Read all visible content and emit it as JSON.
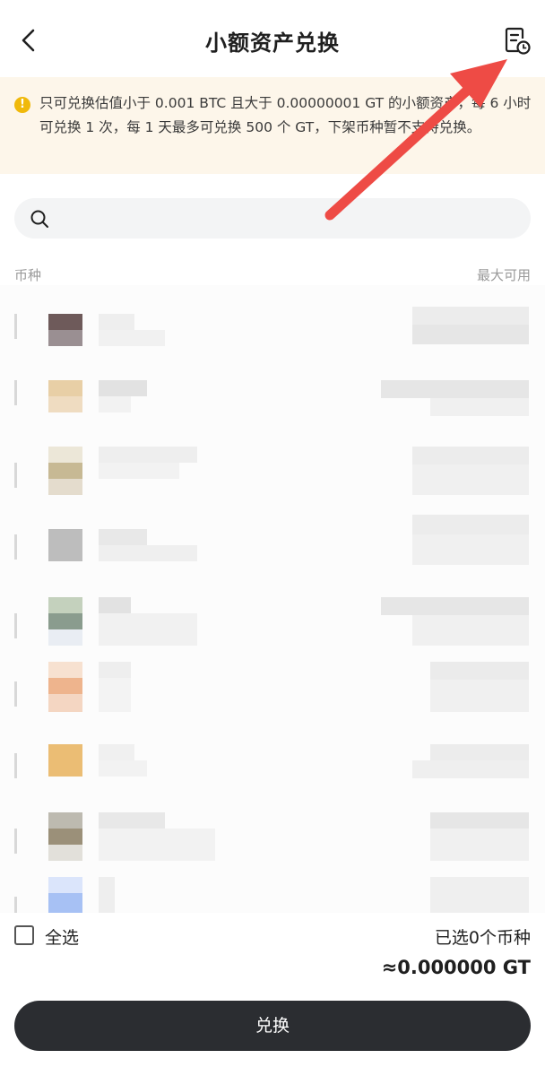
{
  "header": {
    "title": "小额资产兑换",
    "back_icon": "chevron-left-icon",
    "history_icon": "history-record-icon"
  },
  "notice": {
    "icon": "info-icon",
    "text": "只可兑换估值小于 0.001 BTC 且大于 0.00000001 GT 的小额资产，每 6 小时可兑换 1 次，每 1 天最多可兑换 500 个 GT，下架币种暂不支持兑换。"
  },
  "search": {
    "icon": "search-icon",
    "value": ""
  },
  "list_header": {
    "left": "币种",
    "right": "最大可用"
  },
  "footer": {
    "select_all": "全选",
    "selected_count": "已选0个币种",
    "total": "≈0.000000 GT",
    "convert_button": "兑换"
  },
  "colors": {
    "notice_bg": "#fdf6ea",
    "warning": "#f0b90b",
    "button_bg": "#2b2d31",
    "annotation_arrow": "#ee4b45"
  }
}
